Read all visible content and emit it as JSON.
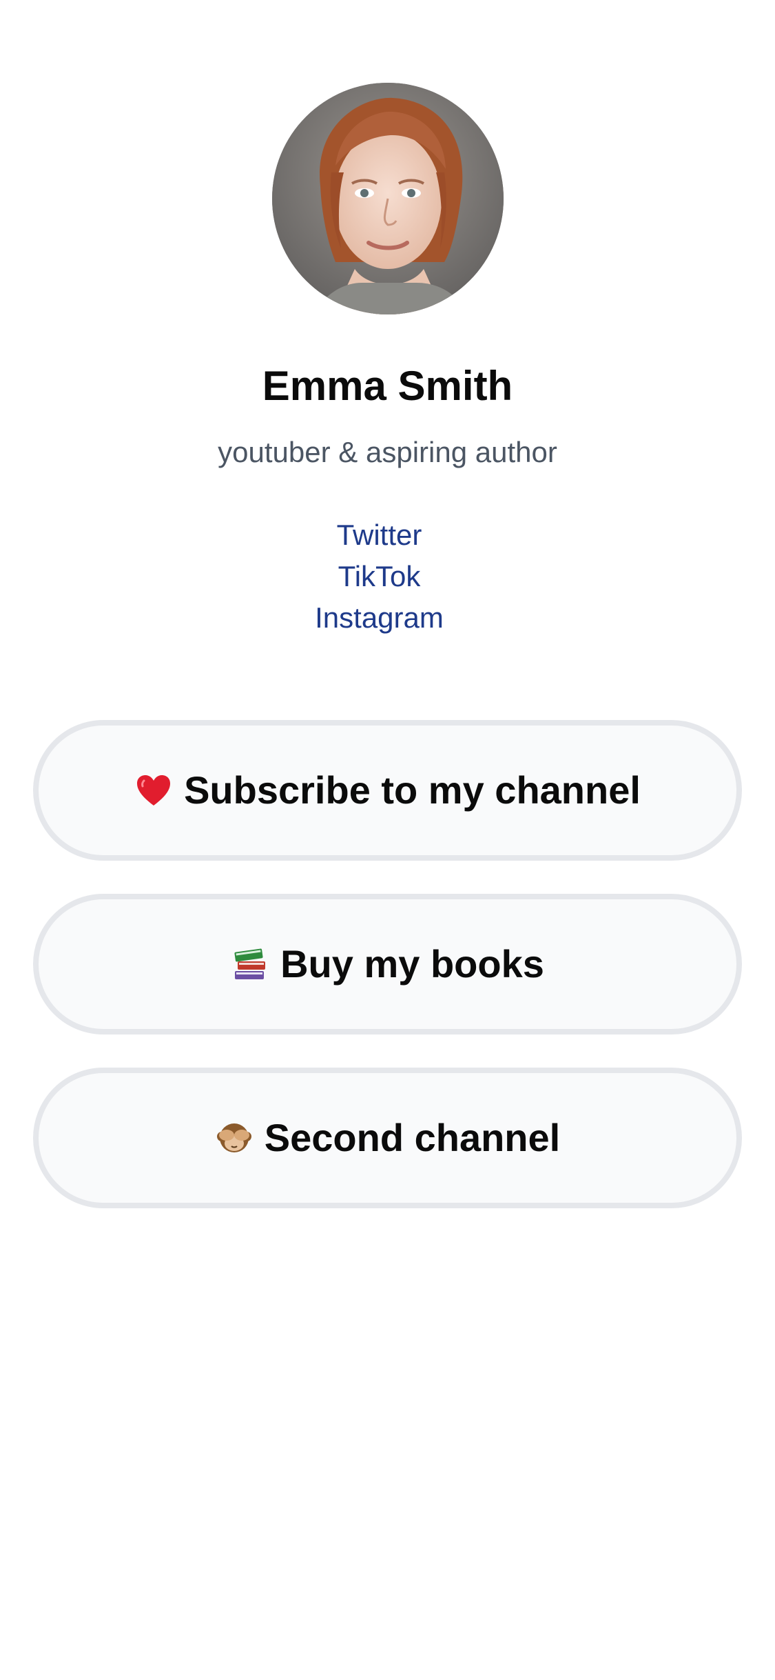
{
  "profile": {
    "name": "Emma Smith",
    "bio": "youtuber & aspiring author",
    "avatar_alt": "avatar-photo"
  },
  "social_links": [
    {
      "label": "Twitter"
    },
    {
      "label": "TikTok"
    },
    {
      "label": "Instagram"
    }
  ],
  "link_buttons": [
    {
      "emoji_icon": "red-heart-icon",
      "label": "Subscribe to my channel"
    },
    {
      "emoji_icon": "books-icon",
      "label": "Buy my books"
    },
    {
      "emoji_icon": "see-no-evil-monkey-icon",
      "label": "Second channel"
    }
  ],
  "colors": {
    "link_text": "#1e3a8a",
    "bio_text": "#4b5563",
    "button_border": "#e5e7eb",
    "button_bg": "#f9fafb"
  }
}
